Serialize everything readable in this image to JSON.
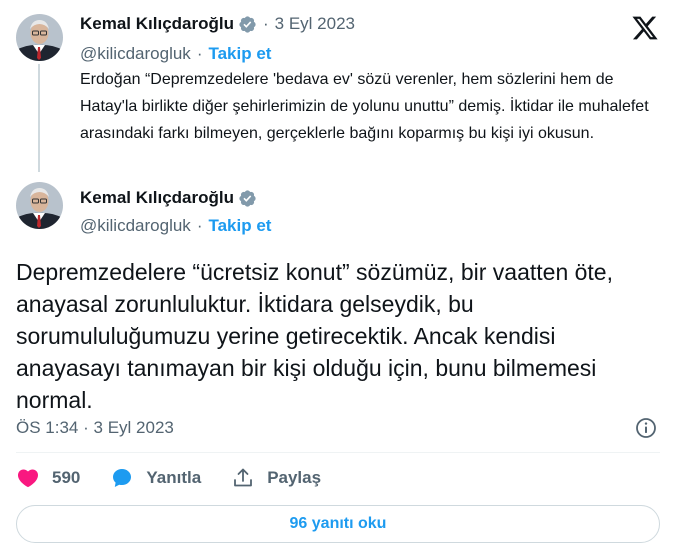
{
  "parent_tweet": {
    "author_name": "Kemal Kılıçdaroğlu",
    "date": "3 Eyl 2023",
    "separator": "·",
    "handle": "@kilicdarogluk",
    "follow_label": "Takip et",
    "text": "Erdoğan “Depremzedelere 'bedava ev' sözü verenler, hem sözlerini hem de Hatay'la birlikte diğer şehirlerimizin de yolunu unuttu” demiş. İktidar ile muhalefet arasındaki farkı bilmeyen, gerçeklerle bağını koparmış bu kişi iyi okusun."
  },
  "main_tweet": {
    "author_name": "Kemal Kılıçdaroğlu",
    "separator": "·",
    "handle": "@kilicdarogluk",
    "follow_label": "Takip et",
    "text": "Depremzedelere “ücretsiz konut” sözümüz, bir vaatten öte, anayasal zorunluluktur. İktidara gelseydik, bu sorumululuğumuzu yerine getirecektik. Ancak kendisi anayasayı tanımayan bir kişi olduğu için, bunu bilmemesi normal.",
    "time": "ÖS 1:34",
    "date": "3 Eyl 2023"
  },
  "actions": {
    "like_count": "590",
    "reply_label": "Yanıtla",
    "share_label": "Paylaş"
  },
  "read_replies_label": "96 yanıtı oku",
  "icons": {
    "logo": "x-logo-icon",
    "verified": "verified-badge-icon",
    "info": "info-icon",
    "like": "heart-icon",
    "reply": "speech-bubble-icon",
    "share": "share-icon"
  },
  "colors": {
    "accent": "#1d9bf0",
    "like": "#f91880",
    "muted": "#536471",
    "text": "#0f1419"
  }
}
